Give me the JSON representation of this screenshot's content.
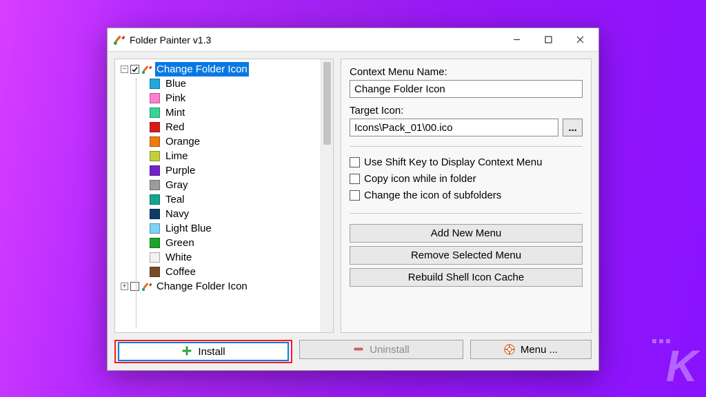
{
  "window": {
    "title": "Folder Painter v1.3",
    "controls": {
      "minimize": "minimize",
      "maximize": "maximize",
      "close": "close"
    }
  },
  "tree": {
    "root1": {
      "label": "Change Folder Icon",
      "checked": true,
      "expanded": true,
      "selected": true
    },
    "root2": {
      "label": "Change Folder Icon",
      "checked": false,
      "expanded": false
    },
    "items": [
      {
        "label": "Blue",
        "color": "#1ea9e1"
      },
      {
        "label": "Pink",
        "color": "#ff7fce"
      },
      {
        "label": "Mint",
        "color": "#38d497"
      },
      {
        "label": "Red",
        "color": "#d91b1b"
      },
      {
        "label": "Orange",
        "color": "#f07b0c"
      },
      {
        "label": "Lime",
        "color": "#c3d03a"
      },
      {
        "label": "Purple",
        "color": "#7323c7"
      },
      {
        "label": "Gray",
        "color": "#9c9c9c"
      },
      {
        "label": "Teal",
        "color": "#11a793"
      },
      {
        "label": "Navy",
        "color": "#0e3d6b"
      },
      {
        "label": "Light Blue",
        "color": "#7fd2f5"
      },
      {
        "label": "Green",
        "color": "#1aa529"
      },
      {
        "label": "White",
        "color": "#f2f2f2"
      },
      {
        "label": "Coffee",
        "color": "#7b4a29"
      }
    ]
  },
  "form": {
    "context_name_label": "Context Menu Name:",
    "context_name_value": "Change Folder Icon",
    "target_icon_label": "Target Icon:",
    "target_icon_value": "Icons\\Pack_01\\00.ico",
    "browse_label": "...",
    "opt_shift": "Use Shift Key to Display Context Menu",
    "opt_copy": "Copy icon while in folder",
    "opt_sub": "Change the icon of subfolders",
    "btn_add": "Add New Menu",
    "btn_remove": "Remove Selected Menu",
    "btn_rebuild": "Rebuild Shell Icon Cache"
  },
  "bottom": {
    "install": "Install",
    "uninstall": "Uninstall",
    "menu": "Menu ..."
  },
  "icons": {
    "plus_color": "#34c43a",
    "minus_color": "#d63a3a",
    "ring_outer": "#e24a1a",
    "ring_inner": "#ffffff"
  }
}
